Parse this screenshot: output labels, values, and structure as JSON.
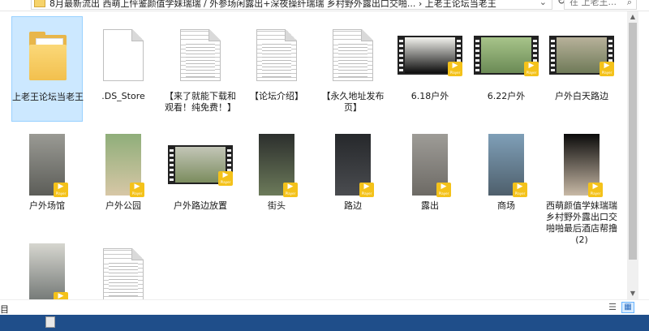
{
  "address_bar": {
    "path": "8月最新流出 西萌上怦鉴颜值学妹瑞瑞 / 外参场闲露出+深夜操纤瑞瑞 乡村野外露出口交啪... › 上老王论坛当老王",
    "search_placeholder": "在 上老王..."
  },
  "files": [
    {
      "label": "上老王论坛当老王",
      "type": "folder",
      "selected": true
    },
    {
      "label": ".DS_Store",
      "type": "doc"
    },
    {
      "label": "【来了就能下载和观看！纯免费！】",
      "type": "doc-lined"
    },
    {
      "label": "【论坛介绍】",
      "type": "doc-lined"
    },
    {
      "label": "【永久地址发布页】",
      "type": "doc-lined"
    },
    {
      "label": "6.18户外",
      "type": "film",
      "scene": [
        "#f3f3ee",
        "#0d0d0d"
      ]
    },
    {
      "label": "6.22户外",
      "type": "film",
      "scene": [
        "#a7c48a",
        "#6b8a55"
      ]
    },
    {
      "label": "户外白天路边",
      "type": "film",
      "scene": [
        "#b7b19a",
        "#6f7a58"
      ]
    },
    {
      "label": "户外场馆",
      "type": "portrait",
      "scene": [
        "#9a9a94",
        "#5c5d58"
      ]
    },
    {
      "label": "户外公园",
      "type": "portrait",
      "scene": [
        "#8fae7a",
        "#d7c7a6"
      ]
    },
    {
      "label": "户外路边放置",
      "type": "film",
      "scene": [
        "#c3c6b7",
        "#7b8c5e"
      ]
    },
    {
      "label": "街头",
      "type": "portrait",
      "scene": [
        "#2c2f2d",
        "#6c7a5a"
      ]
    },
    {
      "label": "路边",
      "type": "portrait",
      "scene": [
        "#26282b",
        "#4a4c50"
      ]
    },
    {
      "label": "露出",
      "type": "portrait",
      "scene": [
        "#9e9c97",
        "#6d6a65"
      ]
    },
    {
      "label": "商场",
      "type": "portrait",
      "scene": [
        "#7f9fb8",
        "#4e5f6c"
      ]
    },
    {
      "label": "西萌颜值学妹瑞瑞乡村野外露出口交啪啪最后酒店帮撸(2)",
      "type": "portrait",
      "scene": [
        "#0b0b0b",
        "#c8b9a6"
      ]
    },
    {
      "label": "",
      "type": "portrait",
      "scene": [
        "#d6d6cf",
        "#6d7270"
      ]
    },
    {
      "label": "",
      "type": "doc-lined"
    }
  ],
  "badge": {
    "symbol": "▶",
    "text": "Player"
  },
  "status": {
    "text": "目"
  },
  "icons": {
    "search": "search-icon",
    "refresh": "refresh-icon",
    "dropdown": "chevron-down-icon",
    "details_view": "details-view-icon",
    "large_icons_view": "large-icons-view-icon"
  }
}
